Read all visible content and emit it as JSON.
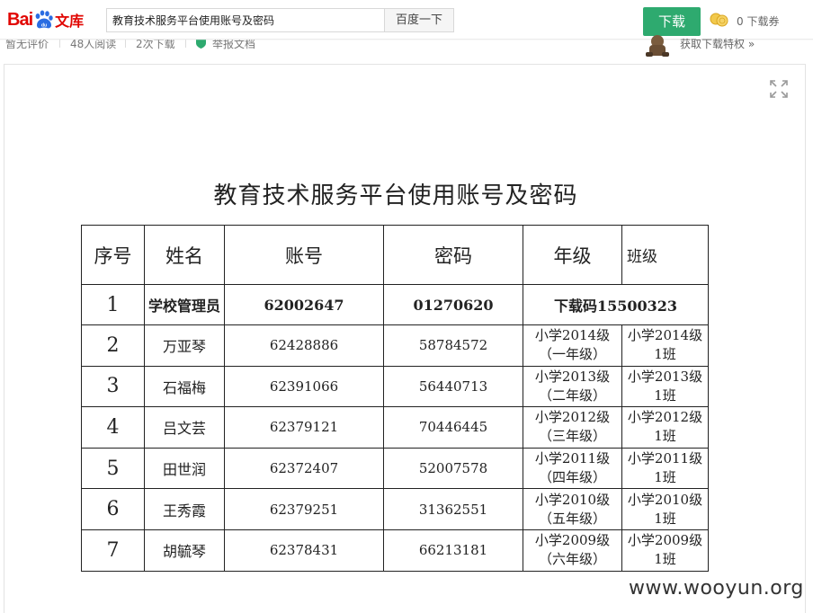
{
  "header": {
    "logo": {
      "bai": "Bai",
      "wenku": "文库"
    },
    "search": {
      "value": "教育技术服务平台使用账号及密码",
      "button_label": "百度一下"
    },
    "download_label": "下载",
    "coupon_text": "0 下载券",
    "meta": [
      "暂无评价",
      "48人阅读",
      "2次下载",
      "举报文档"
    ],
    "privilege_link": "获取下载特权 »"
  },
  "colors": {
    "brand_red": "#e10602",
    "brand_blue": "#2b6de2",
    "download_green": "#2eaa6f"
  },
  "icons": [
    "baidu-paw-icon",
    "coin-icon",
    "shield-icon",
    "mascot-icon",
    "fullscreen-icon"
  ],
  "document": {
    "title": "教育技术服务平台使用账号及密码",
    "table": {
      "headers": [
        "序号",
        "姓名",
        "账号",
        "密码",
        "年级",
        "班级"
      ],
      "admin": {
        "no": "1",
        "name": "学校管理员",
        "account": "62002647",
        "password": "01270620",
        "note": "下载码15500323"
      },
      "rows": [
        {
          "no": "2",
          "name": "万亚琴",
          "account": "62428886",
          "password": "58784572",
          "grade_1": "小学2014级",
          "grade_2": "（一年级）",
          "cls_1": "小学2014级",
          "cls_2": "1班"
        },
        {
          "no": "3",
          "name": "石福梅",
          "account": "62391066",
          "password": "56440713",
          "grade_1": "小学2013级",
          "grade_2": "（二年级）",
          "cls_1": "小学2013级",
          "cls_2": "1班"
        },
        {
          "no": "4",
          "name": "吕文芸",
          "account": "62379121",
          "password": "70446445",
          "grade_1": "小学2012级",
          "grade_2": "（三年级）",
          "cls_1": "小学2012级",
          "cls_2": "1班"
        },
        {
          "no": "5",
          "name": "田世润",
          "account": "62372407",
          "password": "52007578",
          "grade_1": "小学2011级",
          "grade_2": "（四年级）",
          "cls_1": "小学2011级",
          "cls_2": "1班"
        },
        {
          "no": "6",
          "name": "王秀霞",
          "account": "62379251",
          "password": "31362551",
          "grade_1": "小学2010级",
          "grade_2": "（五年级）",
          "cls_1": "小学2010级",
          "cls_2": "1班"
        },
        {
          "no": "7",
          "name": "胡毓琴",
          "account": "62378431",
          "password": "66213181",
          "grade_1": "小学2009级",
          "grade_2": "（六年级）",
          "cls_1": "小学2009级",
          "cls_2": "1班"
        }
      ]
    }
  },
  "watermark": "www.wooyun.org"
}
